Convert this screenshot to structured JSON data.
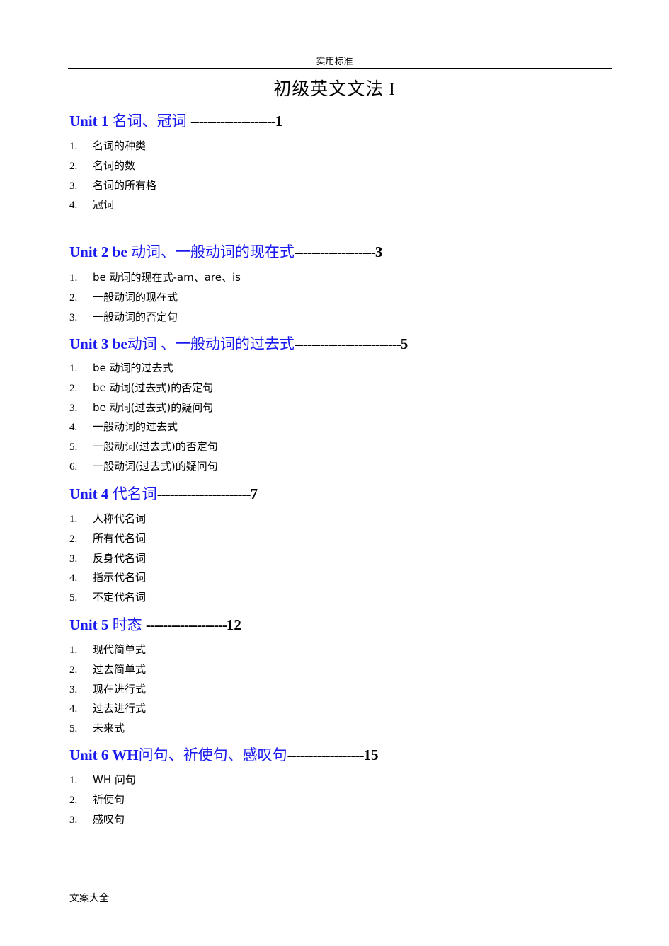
{
  "header": {
    "text": "实用标准"
  },
  "title": "初级英文文法  I",
  "units": [
    {
      "prefix": "Unit 1 ",
      "name": "名词、冠词 ",
      "leader": "--------------------",
      "page": "1",
      "items": [
        {
          "num": "1.",
          "label": "名词的种类"
        },
        {
          "num": "2.",
          "label": "名词的数"
        },
        {
          "num": "3.",
          "label": "名词的所有格"
        },
        {
          "num": "4.",
          "label": "冠词"
        }
      ]
    },
    {
      "prefix": "Unit 2 be ",
      "name": "动词、一般动词的现在式",
      "leader": "-------------------",
      "page": "3",
      "items": [
        {
          "num": "1.",
          "label": "be 动词的现在式-am、are、is"
        },
        {
          "num": "2.",
          "label": "一般动词的现在式"
        },
        {
          "num": "3.",
          "label": "一般动词的否定句"
        }
      ]
    },
    {
      "prefix": "Unit 3 be",
      "name": "动词 、一般动词的过去式",
      "leader": "-------------------------",
      "page": "5",
      "items": [
        {
          "num": "1.",
          "label": "be 动词的过去式"
        },
        {
          "num": "2.",
          "label": "be 动词(过去式)的否定句"
        },
        {
          "num": "3.",
          "label": "be 动词(过去式)的疑问句"
        },
        {
          "num": "4.",
          "label": "一般动词的过去式"
        },
        {
          "num": "5.",
          "label": "一般动词(过去式)的否定句"
        },
        {
          "num": "6.",
          "label": "一般动词(过去式)的疑问句"
        }
      ]
    },
    {
      "prefix": "Unit 4 ",
      "name": "代名词",
      "leader": "----------------------",
      "page": "7",
      "items": [
        {
          "num": "1.",
          "label": "人称代名词"
        },
        {
          "num": "2.",
          "label": "所有代名词"
        },
        {
          "num": "3.",
          "label": "反身代名词"
        },
        {
          "num": "4.",
          "label": "指示代名词"
        },
        {
          "num": "5.",
          "label": "不定代名词"
        }
      ]
    },
    {
      "prefix": "Unit 5 ",
      "name": "时态 ",
      "leader": "-------------------",
      "page": "12",
      "items": [
        {
          "num": "1.",
          "label": "现代简单式"
        },
        {
          "num": "2.",
          "label": "过去简单式"
        },
        {
          "num": "3.",
          "label": "现在进行式"
        },
        {
          "num": "4.",
          "label": "过去进行式"
        },
        {
          "num": "5.",
          "label": "未来式"
        }
      ]
    },
    {
      "prefix": "Unit 6 WH",
      "name": "问句、祈使句、感叹句",
      "leader": "------------------",
      "page": "15",
      "items": [
        {
          "num": "1.",
          "label": "WH 问句"
        },
        {
          "num": "2.",
          "label": "祈使句"
        },
        {
          "num": "3.",
          "label": "感叹句"
        }
      ]
    }
  ],
  "footer": {
    "text": "文案大全"
  }
}
